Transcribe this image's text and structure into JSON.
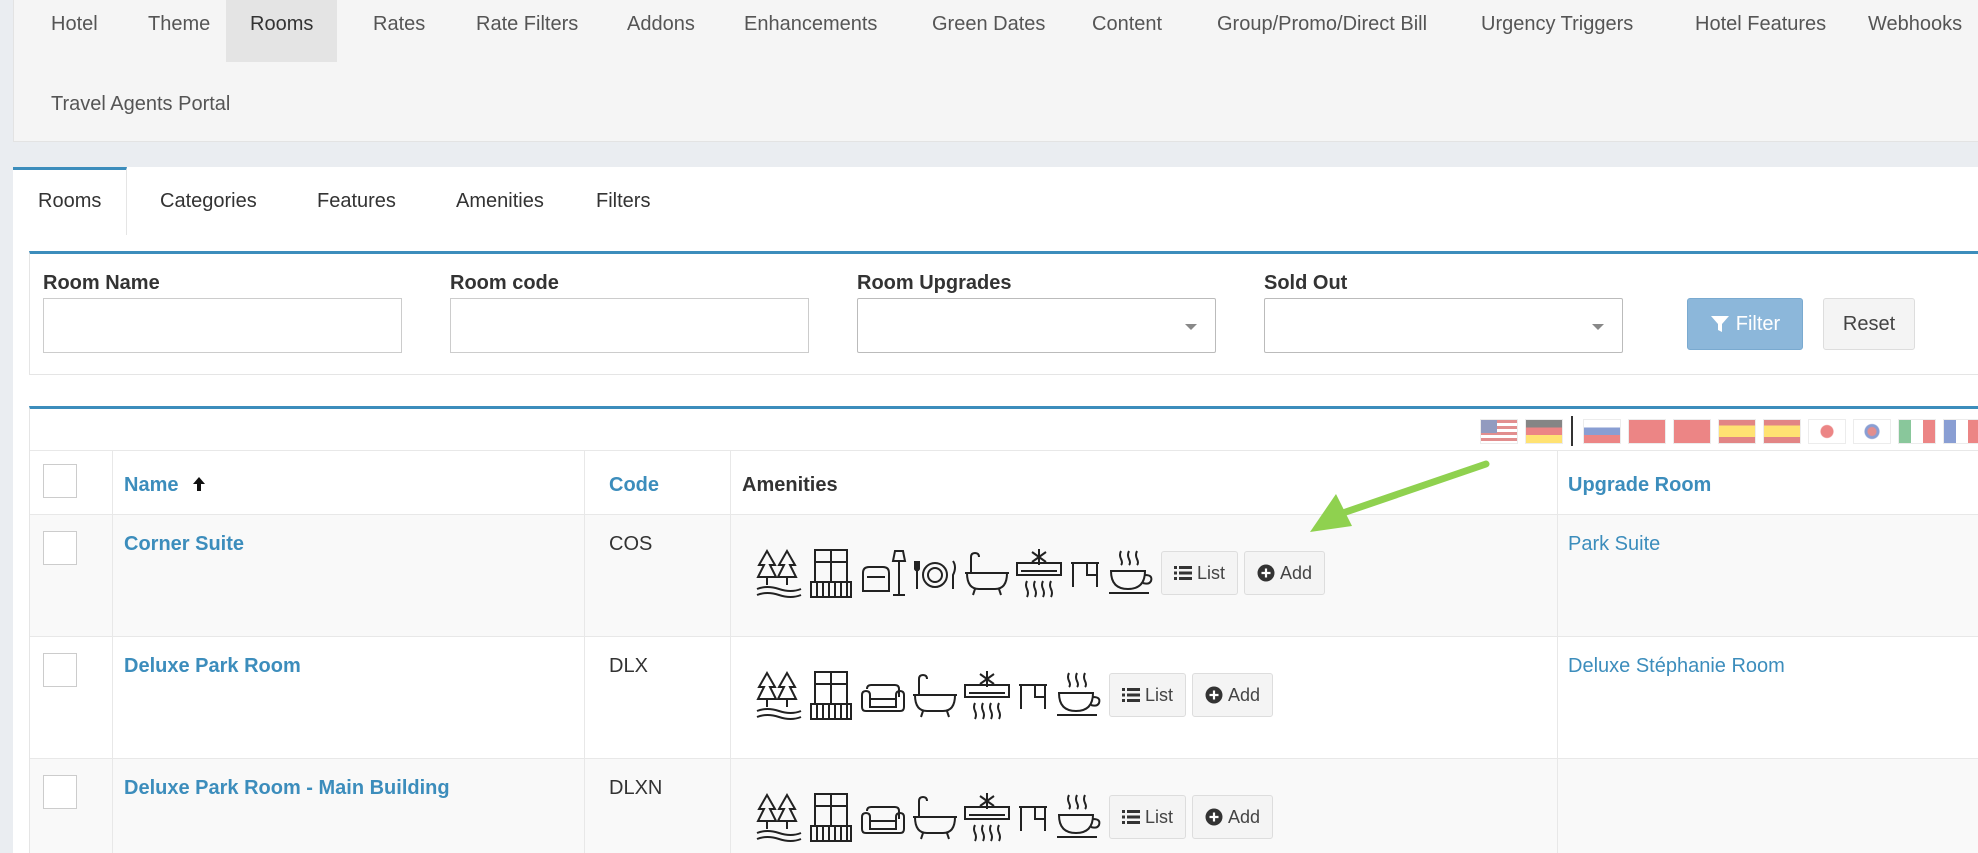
{
  "top_nav": {
    "tabs": [
      {
        "label": "Hotel",
        "active": false
      },
      {
        "label": "Theme",
        "active": false
      },
      {
        "label": "Rooms",
        "active": true
      },
      {
        "label": "Rates",
        "active": false
      },
      {
        "label": "Rate Filters",
        "active": false
      },
      {
        "label": "Addons",
        "active": false
      },
      {
        "label": "Enhancements",
        "active": false
      },
      {
        "label": "Green Dates",
        "active": false
      },
      {
        "label": "Content",
        "active": false
      },
      {
        "label": "Group/Promo/Direct Bill",
        "active": false
      },
      {
        "label": "Urgency Triggers",
        "active": false
      },
      {
        "label": "Hotel Features",
        "active": false
      },
      {
        "label": "Webhooks",
        "active": false
      },
      {
        "label": "Travel Agents Portal",
        "active": false
      }
    ]
  },
  "sub_tabs": [
    {
      "label": "Rooms",
      "active": true
    },
    {
      "label": "Categories",
      "active": false
    },
    {
      "label": "Features",
      "active": false
    },
    {
      "label": "Amenities",
      "active": false
    },
    {
      "label": "Filters",
      "active": false
    }
  ],
  "filters": {
    "room_name_label": "Room Name",
    "room_name_value": "",
    "room_code_label": "Room code",
    "room_code_value": "",
    "room_upgrades_label": "Room Upgrades",
    "room_upgrades_value": "",
    "sold_out_label": "Sold Out",
    "sold_out_value": "",
    "filter_button": "Filter",
    "reset_button": "Reset"
  },
  "languages": [
    "us",
    "de",
    "ru",
    "cn",
    "tw",
    "es",
    "mx",
    "jp",
    "kr",
    "it",
    "fr"
  ],
  "table": {
    "headers": {
      "name": "Name",
      "code": "Code",
      "amenities": "Amenities",
      "upgrade_room": "Upgrade Room"
    },
    "list_button": "List",
    "add_button": "Add",
    "rows": [
      {
        "name": "Corner Suite",
        "code": "COS",
        "upgrade_room": "Park Suite",
        "amenities": [
          "park-view-icon",
          "balcony-icon",
          "armchair-lamp-icon",
          "dining-icon",
          "bathtub-icon",
          "air-conditioning-icon",
          "desk-icon",
          "coffee-cup-icon"
        ]
      },
      {
        "name": "Deluxe Park Room",
        "code": "DLX",
        "upgrade_room": "Deluxe Stéphanie Room",
        "amenities": [
          "park-view-icon",
          "balcony-icon",
          "sofa-icon",
          "bathtub-icon",
          "air-conditioning-icon",
          "desk-icon",
          "coffee-cup-icon"
        ]
      },
      {
        "name": "Deluxe Park Room - Main Building",
        "code": "DLXN",
        "upgrade_room": "",
        "amenities": [
          "park-view-icon",
          "balcony-icon",
          "sofa-icon",
          "bathtub-icon",
          "air-conditioning-icon",
          "desk-icon",
          "coffee-cup-icon"
        ]
      }
    ]
  },
  "colors": {
    "accent": "#3c8dbc",
    "filter_button": "#8cb7da",
    "annotation_arrow": "#8fd14f"
  }
}
